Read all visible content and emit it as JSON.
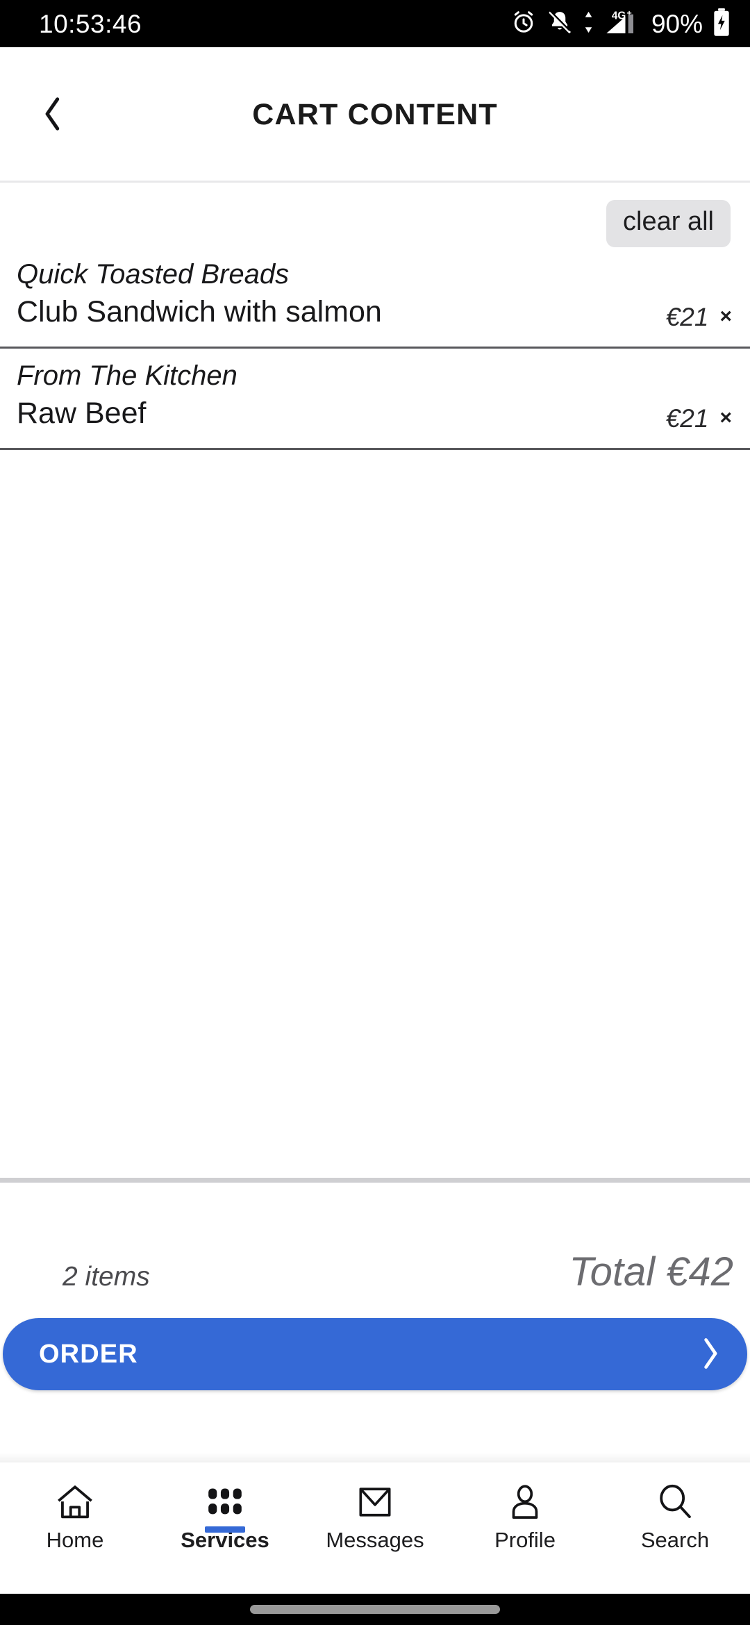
{
  "statusbar": {
    "clock": "10:53:46",
    "battery_percent": "90%",
    "network_label": "4G+",
    "icons": [
      "alarm-clock-icon",
      "bell-muted-icon",
      "data-transfer-icon",
      "signal-4gplus-icon",
      "battery-charging-icon"
    ]
  },
  "header": {
    "title": "CART CONTENT",
    "back_icon": "chevron-left-icon"
  },
  "cart": {
    "clear_all_label": "clear all",
    "remove_glyph": "×",
    "items": [
      {
        "category": "Quick Toasted Breads",
        "name": "Club Sandwich with salmon",
        "price": "€21"
      },
      {
        "category": "From The Kitchen",
        "name": "Raw Beef",
        "price": "€21"
      }
    ]
  },
  "summary": {
    "items_count": "2 items",
    "total": "Total €42",
    "order_label": "ORDER",
    "order_arrow_icon": "chevron-right-icon"
  },
  "bottomnav": {
    "items": [
      {
        "label": "Home",
        "icon": "home-icon",
        "active": false
      },
      {
        "label": "Services",
        "icon": "grid-icon",
        "active": true
      },
      {
        "label": "Messages",
        "icon": "envelope-icon",
        "active": false
      },
      {
        "label": "Profile",
        "icon": "person-icon",
        "active": false
      },
      {
        "label": "Search",
        "icon": "search-icon",
        "active": false
      }
    ]
  },
  "colors": {
    "accent": "#3569d6",
    "separator": "#58585c",
    "chip_bg": "#e3e3e5",
    "total_text": "#6c6c70"
  }
}
